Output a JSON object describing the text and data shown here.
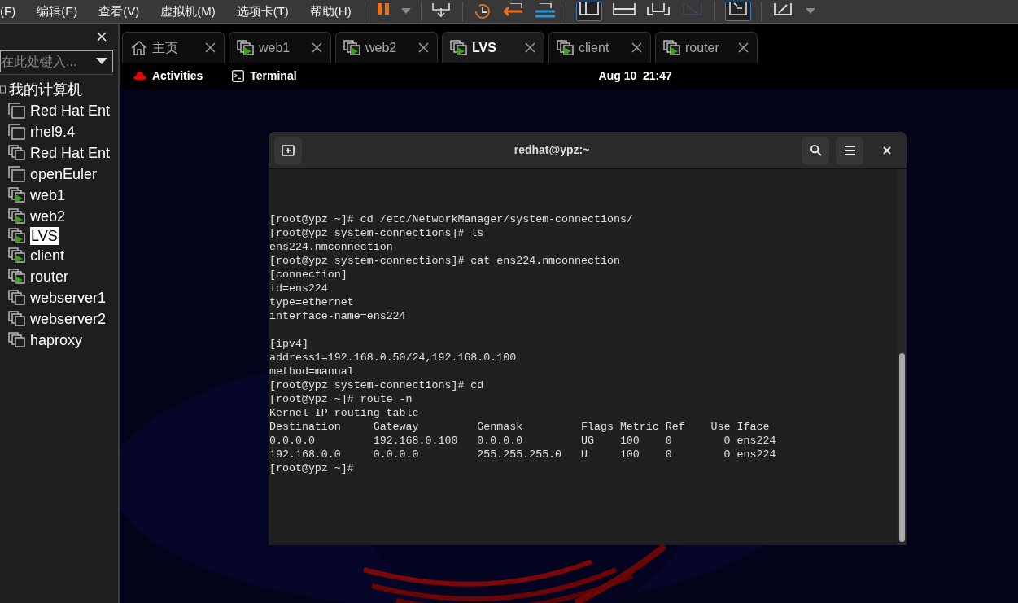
{
  "menu_bar": [
    "(F)",
    "编辑(E)",
    "查看(V)",
    "虚拟机(M)",
    "选项卡(T)",
    "帮助(H)"
  ],
  "sidebar": {
    "search": {
      "placeholder": "在此处键入..."
    },
    "tree": {
      "label": "我的计算机",
      "children": [
        {
          "label": "Red Hat Ent",
          "kind": "single",
          "running": false,
          "selected": false
        },
        {
          "label": "rhel9.4",
          "kind": "single",
          "running": false,
          "selected": false
        },
        {
          "label": "Red Hat Ent",
          "kind": "double",
          "running": false,
          "selected": false
        },
        {
          "label": "openEuler",
          "kind": "single",
          "running": false,
          "selected": false
        },
        {
          "label": "web1",
          "kind": "double",
          "running": true,
          "selected": false
        },
        {
          "label": "web2",
          "kind": "double",
          "running": true,
          "selected": false
        },
        {
          "label": "LVS",
          "kind": "double",
          "running": true,
          "selected": true
        },
        {
          "label": "client",
          "kind": "double",
          "running": true,
          "selected": false
        },
        {
          "label": "router",
          "kind": "double",
          "running": true,
          "selected": false
        },
        {
          "label": "webserver1",
          "kind": "double",
          "running": false,
          "selected": false
        },
        {
          "label": "webserver2",
          "kind": "double",
          "running": false,
          "selected": false
        },
        {
          "label": "haproxy",
          "kind": "double",
          "running": false,
          "selected": false
        }
      ]
    }
  },
  "tabs": [
    {
      "label": "主页",
      "kind": "home",
      "selected": false
    },
    {
      "label": "web1",
      "kind": "vm",
      "selected": false
    },
    {
      "label": "web2",
      "kind": "vm",
      "selected": false
    },
    {
      "label": "LVS",
      "kind": "vm",
      "selected": true
    },
    {
      "label": "client",
      "kind": "vm",
      "selected": false
    },
    {
      "label": "router",
      "kind": "vm",
      "selected": false
    }
  ],
  "guest_top_bar": {
    "activities": "Activities",
    "app": "Terminal",
    "clock": "Aug 10  21:47"
  },
  "terminal": {
    "title": "redhat@ypz:~",
    "lines": [
      {
        "kind": "text",
        "text": "[root@ypz ~]# cd /etc/NetworkManager/system-connections/"
      },
      {
        "kind": "text",
        "text": "[root@ypz system-connections]# ls"
      },
      {
        "kind": "text",
        "text": "ens224.nmconnection"
      },
      {
        "kind": "text",
        "text": "[root@ypz system-connections]# cat ens224.nmconnection"
      },
      {
        "kind": "text",
        "text": "[connection]"
      },
      {
        "kind": "text",
        "text": "id=ens224"
      },
      {
        "kind": "text",
        "text": "type=ethernet"
      },
      {
        "kind": "text",
        "text": "interface-name=ens224"
      },
      {
        "kind": "blank"
      },
      {
        "kind": "text",
        "text": "[ipv4]"
      },
      {
        "kind": "text",
        "text": "address1=192.168.0.50/24,192.168.0.100"
      },
      {
        "kind": "text",
        "text": "method=manual"
      },
      {
        "kind": "text",
        "text": "[root@ypz system-connections]# cd"
      },
      {
        "kind": "text",
        "text": "[root@ypz ~]# route -n"
      },
      {
        "kind": "text",
        "text": "Kernel IP routing table"
      },
      {
        "kind": "text",
        "text": "Destination     Gateway         Genmask         Flags Metric Ref    Use Iface"
      },
      {
        "kind": "text",
        "text": "0.0.0.0         192.168.0.100   0.0.0.0         UG    100    0        0 ens224"
      },
      {
        "kind": "text",
        "text": "192.168.0.0     0.0.0.0         255.255.255.0   U     100    0        0 ens224"
      },
      {
        "kind": "text",
        "text": "[root@ypz ~]#"
      }
    ]
  }
}
